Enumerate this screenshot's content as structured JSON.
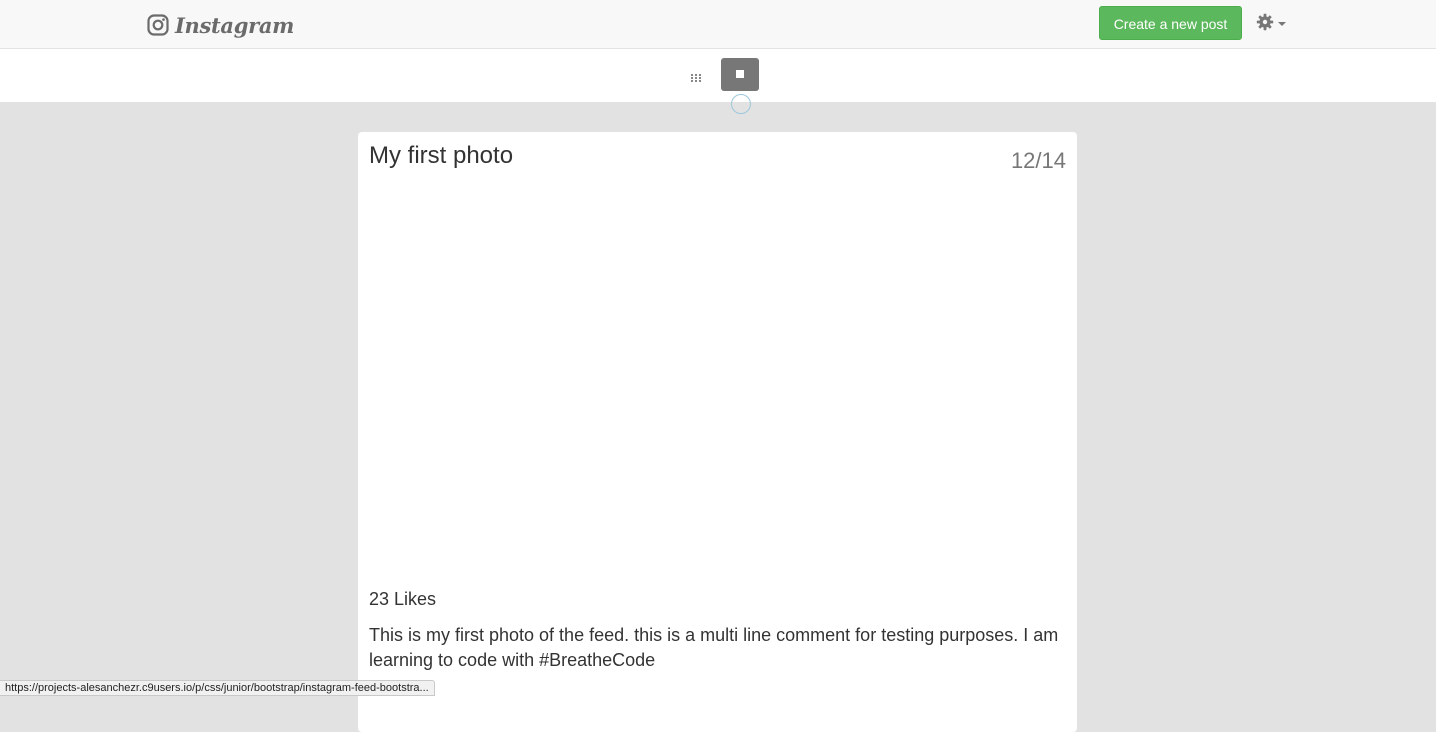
{
  "navbar": {
    "brand": "Instagram",
    "brand_icon": "instagram-camera-icon",
    "create_button_label": "Create a new post",
    "settings_icon": "gear-icon"
  },
  "view_toggle": {
    "grid_icon": "grid-view-icon",
    "single_icon": "single-view-icon",
    "active": "single"
  },
  "post": {
    "title": "My first photo",
    "date": "12/14",
    "likes": "23 Likes",
    "comment": "This is my first photo of the feed. this is a multi line comment for testing purposes. I am learning to code with #BreatheCode"
  },
  "status_bar": {
    "url": "https://projects-alesanchezr.c9users.io/p/css/junior/bootstrap/instagram-feed-bootstra..."
  },
  "colors": {
    "create_button": "#5cb85c",
    "active_toggle": "#777777",
    "page_background": "#e2e2e2"
  }
}
